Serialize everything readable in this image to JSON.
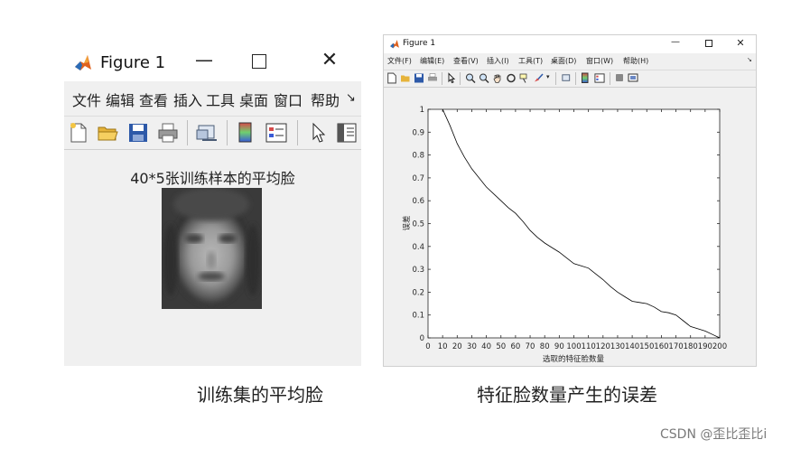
{
  "window1": {
    "title": "Figure 1",
    "menu": [
      "文件",
      "编辑",
      "查看",
      "插入",
      "工具",
      "桌面",
      "窗口",
      "帮助"
    ],
    "menu_overflow": "↘",
    "figure_title": "40*5张训练样本的平均脸"
  },
  "window2": {
    "title": "Figure 1",
    "menu": [
      "文件(F)",
      "编辑(E)",
      "查看(V)",
      "插入(I)",
      "工具(T)",
      "桌面(D)",
      "窗口(W)",
      "帮助(H)"
    ],
    "menu_overflow": "↘"
  },
  "chart_data": {
    "type": "line",
    "title": "",
    "xlabel": "选取的特征脸数量",
    "ylabel": "误差",
    "xlim": [
      0,
      200
    ],
    "ylim": [
      0,
      1
    ],
    "xticks": [
      "0",
      "10",
      "20",
      "30",
      "40",
      "50",
      "60",
      "70",
      "80",
      "90",
      "100",
      "110",
      "120",
      "130",
      "140",
      "150",
      "160",
      "170",
      "180",
      "190",
      "200"
    ],
    "yticks": [
      "0",
      "0.1",
      "0.2",
      "0.3",
      "0.4",
      "0.5",
      "0.6",
      "0.7",
      "0.8",
      "0.9",
      "1"
    ],
    "series": [
      {
        "x": [
          10,
          15,
          20,
          25,
          30,
          35,
          40,
          45,
          50,
          55,
          60,
          65,
          70,
          75,
          80,
          85,
          90,
          95,
          100,
          105,
          110,
          115,
          120,
          125,
          130,
          135,
          140,
          145,
          150,
          155,
          160,
          165,
          170,
          175,
          180,
          185,
          190,
          195,
          200
        ],
        "y": [
          1.0,
          0.93,
          0.85,
          0.79,
          0.74,
          0.7,
          0.66,
          0.63,
          0.6,
          0.57,
          0.545,
          0.51,
          0.47,
          0.44,
          0.415,
          0.395,
          0.375,
          0.35,
          0.325,
          0.315,
          0.305,
          0.28,
          0.255,
          0.225,
          0.2,
          0.18,
          0.16,
          0.155,
          0.15,
          0.135,
          0.115,
          0.11,
          0.1,
          0.075,
          0.05,
          0.04,
          0.03,
          0.015,
          0.0
        ]
      }
    ],
    "grid": false,
    "line_color": "#000000"
  },
  "captions": {
    "left": "训练集的平均脸",
    "right": "特征脸数量产生的误差"
  },
  "watermark": "CSDN @歪比歪比i"
}
